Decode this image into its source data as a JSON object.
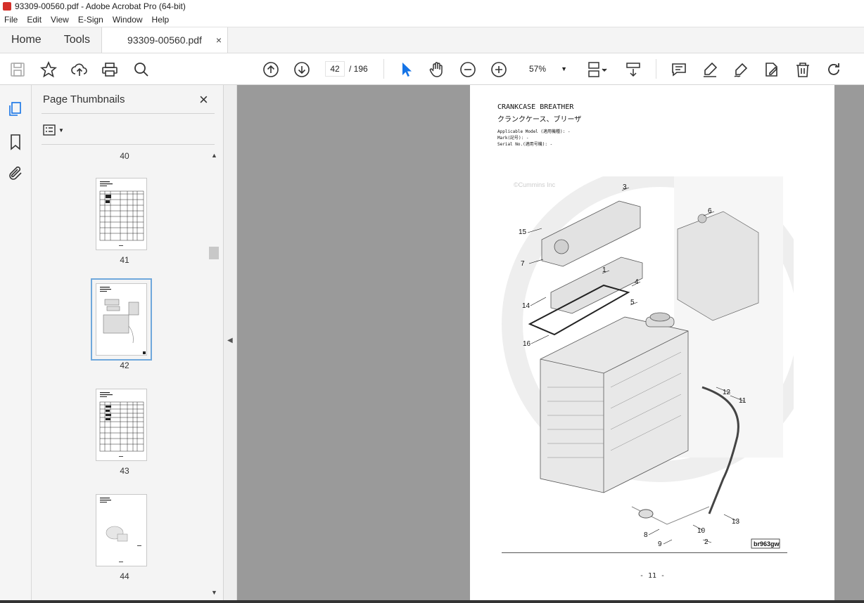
{
  "window": {
    "title": "93309-00560.pdf - Adobe Acrobat Pro (64-bit)"
  },
  "menu": [
    "File",
    "Edit",
    "View",
    "E-Sign",
    "Window",
    "Help"
  ],
  "tabs": {
    "home": "Home",
    "tools": "Tools",
    "doc": "93309-00560.pdf",
    "close": "×"
  },
  "toolbar": {
    "page_current": "42",
    "page_total": "/ 196",
    "zoom": "57%"
  },
  "panel": {
    "title": "Page Thumbnails",
    "close": "×",
    "thumbnails": [
      {
        "label": "40"
      },
      {
        "label": "41"
      },
      {
        "label": "42",
        "selected": true
      },
      {
        "label": "43"
      },
      {
        "label": "44"
      }
    ]
  },
  "document": {
    "title_en": "CRANKCASE BREATHER",
    "title_jp": "クランクケース、ブリーザ",
    "applicable_model": "Applicable Model (適用機種): -",
    "mark": "Mark(記号): -",
    "serial": "Serial No.(適用号機): -",
    "watermark": "©Cummins Inc",
    "figure_code": "br963gw",
    "footer": "- 11 -",
    "callouts": [
      "1",
      "2",
      "3",
      "4",
      "5",
      "6",
      "7",
      "8",
      "9",
      "10",
      "11",
      "12",
      "13",
      "14",
      "15",
      "16"
    ]
  },
  "icons": {
    "save": "save-icon",
    "bookmark": "star-icon",
    "upload": "cloud-upload-icon",
    "print": "printer-icon",
    "search": "magnifier-icon",
    "prev": "arrow-up-circle-icon",
    "next": "arrow-down-circle-icon",
    "select": "pointer-icon",
    "hand": "hand-icon",
    "zoomout": "minus-circle-icon",
    "zoomin": "plus-circle-icon"
  }
}
